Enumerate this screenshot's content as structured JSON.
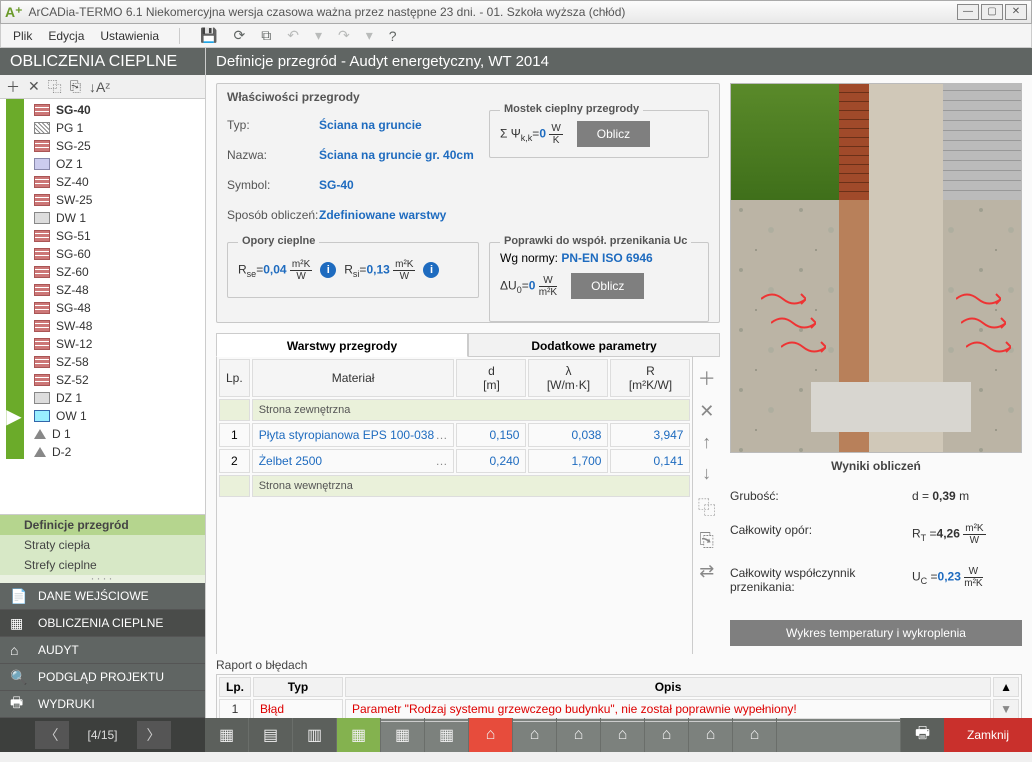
{
  "window": {
    "title": "ArCADia-TERMO 6.1 Niekomercyjna wersja czasowa ważna przez następne 23 dni. - 01. Szkoła wyższa (chłód)"
  },
  "menu": {
    "items": [
      "Plik",
      "Edycja",
      "Ustawienia"
    ]
  },
  "left": {
    "title": "OBLICZENIA CIEPLNE",
    "tree": [
      {
        "label": "SG-40",
        "icon": "brick",
        "sel": true
      },
      {
        "label": "PG 1",
        "icon": "hatch"
      },
      {
        "label": "SG-25",
        "icon": "brick"
      },
      {
        "label": "OZ 1",
        "icon": "wall"
      },
      {
        "label": "SZ-40",
        "icon": "brick"
      },
      {
        "label": "SW-25",
        "icon": "brick"
      },
      {
        "label": "DW 1",
        "icon": "door"
      },
      {
        "label": "SG-51",
        "icon": "brick"
      },
      {
        "label": "SG-60",
        "icon": "brick"
      },
      {
        "label": "SZ-60",
        "icon": "brick"
      },
      {
        "label": "SZ-48",
        "icon": "brick"
      },
      {
        "label": "SG-48",
        "icon": "brick"
      },
      {
        "label": "SW-48",
        "icon": "brick"
      },
      {
        "label": "SW-12",
        "icon": "brick"
      },
      {
        "label": "SZ-58",
        "icon": "brick"
      },
      {
        "label": "SZ-52",
        "icon": "brick"
      },
      {
        "label": "DZ 1",
        "icon": "door"
      },
      {
        "label": "OW 1",
        "icon": "win"
      },
      {
        "label": "D 1",
        "icon": "tri"
      },
      {
        "label": "D-2",
        "icon": "tri"
      }
    ],
    "sections": [
      {
        "label": "Definicje przegród",
        "active": true
      },
      {
        "label": "Straty ciepła",
        "active": false
      },
      {
        "label": "Strefy cieplne",
        "active": false
      }
    ],
    "nav": [
      {
        "label": "DANE WEJŚCIOWE"
      },
      {
        "label": "OBLICZENIA CIEPLNE",
        "active": true
      },
      {
        "label": "AUDYT"
      },
      {
        "label": "PODGLĄD PROJEKTU"
      },
      {
        "label": "WYDRUKI"
      }
    ]
  },
  "main": {
    "title": "Definicje przegród - Audyt energetyczny, WT 2014",
    "group": "Właściwości przegrody",
    "props": {
      "typ_l": "Typ:",
      "typ": "Ściana na gruncie",
      "nazwa_l": "Nazwa:",
      "nazwa": "Ściana na gruncie gr. 40cm",
      "symbol_l": "Symbol:",
      "symbol": "SG-40",
      "sposob_l": "Sposób obliczeń:",
      "sposob": "Zdefiniowane warstwy"
    },
    "bridge": {
      "title": "Mostek cieplny przegrody",
      "eq": "Σ Ψ",
      "sub": "k,k",
      "eq2": "=",
      "val": "0",
      "unit_top": "W",
      "unit_bot": "K",
      "btn": "Oblicz"
    },
    "opory": {
      "title": "Opory cieplne",
      "rse_l": "R",
      "rse_sub": "se",
      "rse_eq": "=",
      "rse_val": "0,04",
      "rse_ut": "m²K",
      "rse_ub": "W",
      "rsi_l": "R",
      "rsi_sub": "si",
      "rsi_eq": "=",
      "rsi_val": "0,13",
      "rsi_ut": "m²K",
      "rsi_ub": "W"
    },
    "poprawki": {
      "title": "Poprawki do współ. przenikania Uc",
      "norm_l": "Wg normy:",
      "norm": "PN-EN ISO 6946",
      "du_l": "ΔU",
      "du_sub": "0",
      "du_eq": "=",
      "du_val": "0",
      "du_ut": "W",
      "du_ub": "m²K",
      "btn": "Oblicz"
    },
    "tabs": [
      "Warstwy przegrody",
      "Dodatkowe parametry"
    ],
    "table": {
      "headers": {
        "lp": "Lp.",
        "mat": "Materiał",
        "d": "d",
        "d_u": "[m]",
        "l": "λ",
        "l_u": "[W/m·K]",
        "r": "R",
        "r_u": "[m²K/W]"
      },
      "band_out": "Strona zewnętrzna",
      "band_in": "Strona wewnętrzna",
      "rows": [
        {
          "lp": "1",
          "mat": "Płyta styropianowa EPS 100-038",
          "d": "0,150",
          "l": "0,038",
          "r": "3,947"
        },
        {
          "lp": "2",
          "mat": "Żelbet 2500",
          "d": "0,240",
          "l": "1,700",
          "r": "0,141"
        }
      ]
    }
  },
  "results": {
    "title": "Wyniki obliczeń",
    "gr_l": "Grubość:",
    "gr_sym": "d =",
    "gr_val": "0,39",
    "gr_u": "m",
    "rt_l": "Całkowity opór:",
    "rt_sym": "R",
    "rt_sub": "T",
    "rt_eq": "=",
    "rt_val": "4,26",
    "rt_ut": "m²K",
    "rt_ub": "W",
    "uc_l": "Całkowity współczynnik przenikania:",
    "uc_sym": "U",
    "uc_sub": "C",
    "uc_eq": "=",
    "uc_val": "0,23",
    "uc_ut": "W",
    "uc_ub": "m²K",
    "wykres": "Wykres temperatury i wykroplenia"
  },
  "errors": {
    "title": "Raport o błędach",
    "headers": {
      "lp": "Lp.",
      "typ": "Typ",
      "opis": "Opis"
    },
    "rows": [
      {
        "lp": "1",
        "typ": "Błąd",
        "opis": "Parametr \"Rodzaj systemu grzewczego budynku\", nie został poprawnie wypełniony!"
      }
    ]
  },
  "footer": {
    "page": "[4/15]",
    "close": "Zamknij"
  }
}
